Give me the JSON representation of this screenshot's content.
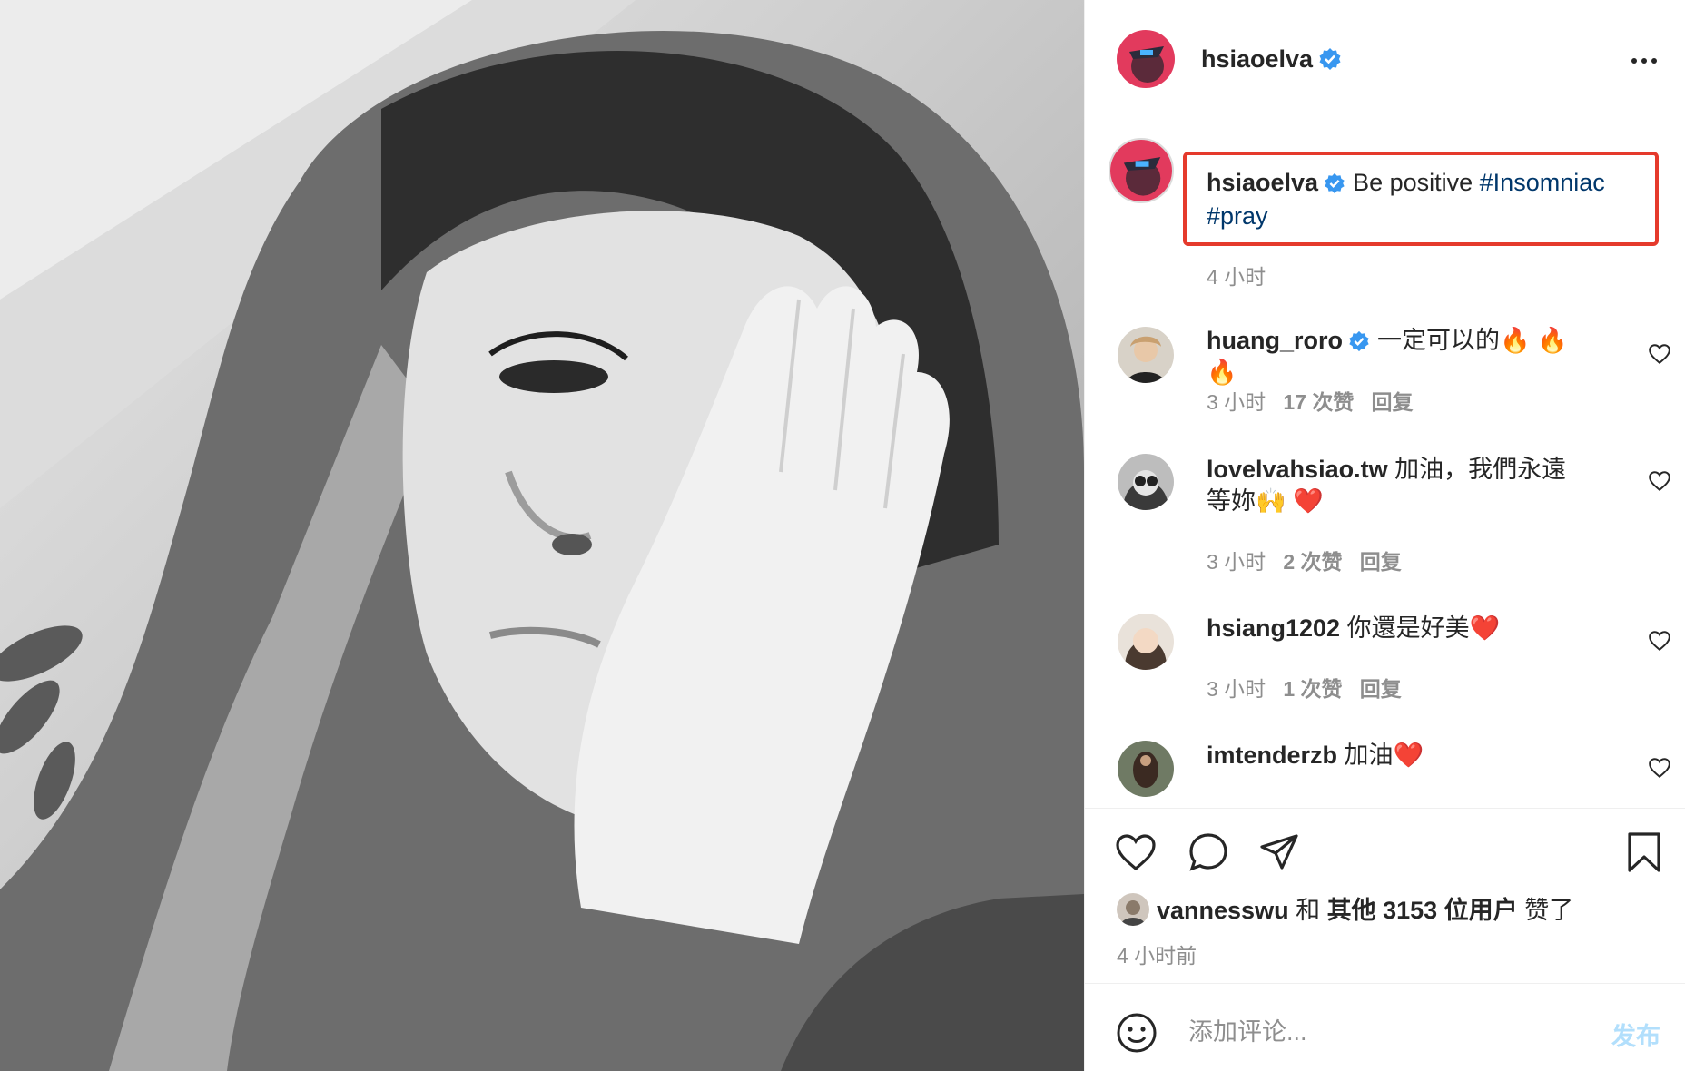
{
  "photo": {
    "description_icon": "selfie-photo"
  },
  "post": {
    "author": "hsiaoelva",
    "verified": true,
    "caption_text": "Be positive ",
    "hashtags": [
      "#Insomniac",
      "#pray"
    ],
    "caption_time": "4 小时"
  },
  "comments": [
    {
      "username": "huang_roro",
      "verified": true,
      "text": "一定可以的🔥 🔥 🔥",
      "time": "3 小时",
      "likes": "17 次赞",
      "reply": "回复"
    },
    {
      "username": "lovelvahsiao.tw",
      "verified": false,
      "text": "加油，我們永遠等妳🙌 ❤️",
      "time": "3 小时",
      "likes": "2 次赞",
      "reply": "回复"
    },
    {
      "username": "hsiang1202",
      "verified": false,
      "text": "你還是好美❤️",
      "time": "3 小时",
      "likes": "1 次赞",
      "reply": "回复"
    },
    {
      "username": "imtenderzb",
      "verified": false,
      "text": "加油❤️"
    }
  ],
  "likes": {
    "user": "vannesswu",
    "and": "和",
    "others": "其他 3153 位用户",
    "suffix": "赞了"
  },
  "posted_time": "4 小时前",
  "add_comment": {
    "placeholder": "添加评论...",
    "post_label": "发布"
  },
  "colors": {
    "accent": "#0095f6",
    "hashtag": "#00376b",
    "highlight_box": "#e53a2c",
    "secondary_text": "#8e8e8e",
    "post_disabled": "#b2dffc"
  }
}
